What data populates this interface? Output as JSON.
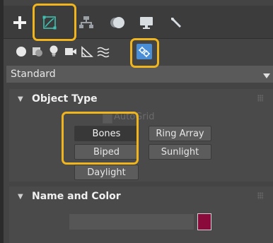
{
  "dropdown": {
    "value": "Standard"
  },
  "object_type": {
    "title": "Object Type",
    "autogrid_label": "AutoGrid",
    "buttons": {
      "bones": "Bones",
      "ring_array": "Ring Array",
      "biped": "Biped",
      "sunlight": "Sunlight",
      "daylight": "Daylight"
    }
  },
  "name_color": {
    "title": "Name and Color",
    "name_value": "",
    "swatch_color": "#8b0a3c"
  },
  "colors": {
    "highlight": "#f0b51d",
    "accent_blue": "#4a8fd6"
  }
}
